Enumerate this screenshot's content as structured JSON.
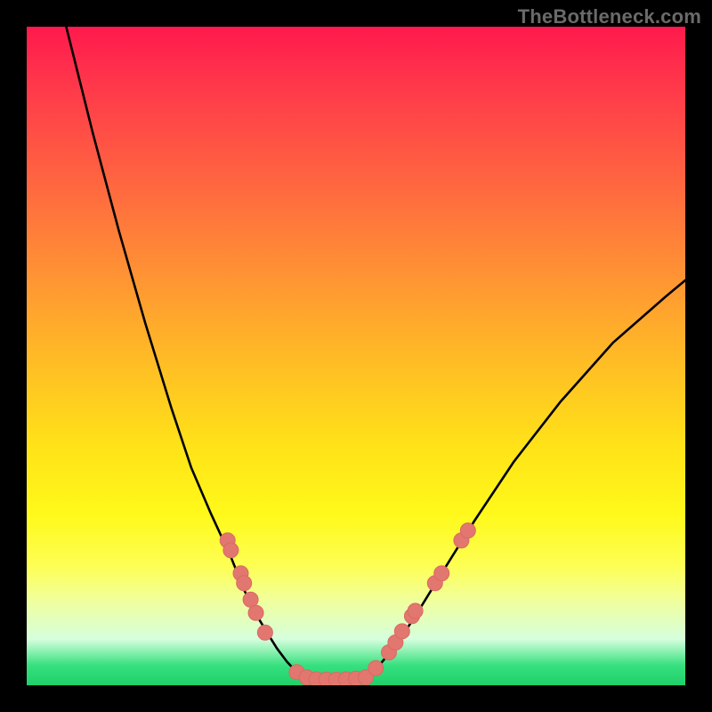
{
  "watermark": "TheBottleneck.com",
  "colors": {
    "frame": "#000000",
    "curve": "#000000",
    "dot_fill": "#e2776f",
    "dot_stroke": "#d86a63",
    "gradient_top": "#ff1a4d",
    "gradient_bottom": "#1fd06a"
  },
  "chart_data": {
    "type": "line",
    "title": "",
    "xlabel": "",
    "ylabel": "",
    "xlim": [
      0,
      100
    ],
    "ylim": [
      0,
      100
    ],
    "grid": false,
    "legend": false,
    "note": "Axes are unlabeled in the source image; x and y are normalized 0–100 estimates read from geometry. y=0 is the bottom of the plot, y=100 is the top. Two monotone curve branches meet in a flat valley (~y=1).",
    "series": [
      {
        "name": "left-branch",
        "x": [
          6,
          10,
          14,
          18,
          22,
          25,
          28,
          31,
          33,
          35,
          36.5,
          38,
          39.5,
          41,
          42.5
        ],
        "y": [
          100,
          84,
          69,
          55,
          42,
          33,
          26,
          19.5,
          14.5,
          10.5,
          8,
          5.6,
          3.6,
          2.0,
          1.1
        ]
      },
      {
        "name": "valley",
        "x": [
          42.5,
          44,
          46,
          48,
          50,
          51.5
        ],
        "y": [
          1.1,
          0.9,
          0.85,
          0.9,
          1.0,
          1.2
        ]
      },
      {
        "name": "right-branch",
        "x": [
          51.5,
          53.5,
          56,
          59,
          63,
          68,
          74,
          81,
          89,
          97,
          100
        ],
        "y": [
          1.2,
          3.0,
          6.0,
          10.5,
          17,
          25,
          34,
          43,
          52,
          59,
          61.5
        ]
      }
    ],
    "dots": {
      "name": "highlighted-points",
      "note": "Clustered markers along lower parts of both branches and across the valley.",
      "points": [
        {
          "x": 30.5,
          "y": 22.0
        },
        {
          "x": 31.0,
          "y": 20.5
        },
        {
          "x": 32.5,
          "y": 17.0
        },
        {
          "x": 33.0,
          "y": 15.5
        },
        {
          "x": 34.0,
          "y": 13.0
        },
        {
          "x": 34.8,
          "y": 11.0
        },
        {
          "x": 36.2,
          "y": 8.0
        },
        {
          "x": 41.0,
          "y": 2.0
        },
        {
          "x": 42.5,
          "y": 1.2
        },
        {
          "x": 44.0,
          "y": 0.9
        },
        {
          "x": 45.5,
          "y": 0.85
        },
        {
          "x": 47.0,
          "y": 0.85
        },
        {
          "x": 48.5,
          "y": 0.9
        },
        {
          "x": 50.0,
          "y": 1.0
        },
        {
          "x": 51.5,
          "y": 1.2
        },
        {
          "x": 53.0,
          "y": 2.6
        },
        {
          "x": 55.0,
          "y": 5.0
        },
        {
          "x": 56.0,
          "y": 6.5
        },
        {
          "x": 57.0,
          "y": 8.2
        },
        {
          "x": 58.5,
          "y": 10.5
        },
        {
          "x": 59.0,
          "y": 11.3
        },
        {
          "x": 62.0,
          "y": 15.5
        },
        {
          "x": 63.0,
          "y": 17.0
        },
        {
          "x": 66.0,
          "y": 22.0
        },
        {
          "x": 67.0,
          "y": 23.5
        }
      ]
    }
  }
}
